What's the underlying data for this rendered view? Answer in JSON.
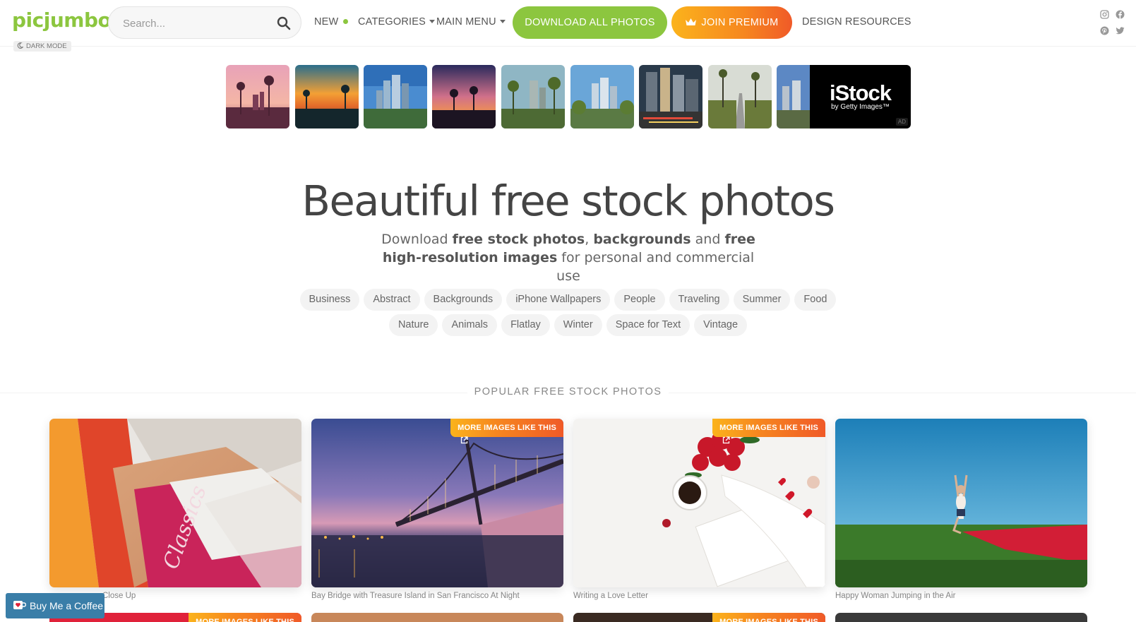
{
  "header": {
    "logo": "picjumbo",
    "search_placeholder": "Search...",
    "nav_new": "NEW",
    "nav_categories": "CATEGORIES",
    "nav_main_menu": "MAIN MENU",
    "download_all": "DOWNLOAD ALL PHOTOS",
    "join_premium": "JOIN PREMIUM",
    "design_resources": "DESIGN RESOURCES",
    "dark_mode": "DARK MODE",
    "social_icons": [
      "instagram-icon",
      "facebook-icon",
      "pinterest-icon",
      "twitter-icon"
    ]
  },
  "ad": {
    "brand": "iStock",
    "brand_sub": "by Getty Images™",
    "badge": "AD"
  },
  "hero": {
    "title": "Beautiful free stock photos",
    "sub_1": "Download ",
    "sub_2": "free stock photos",
    "sub_3": ", ",
    "sub_4": "backgrounds",
    "sub_5": " and ",
    "sub_6": "free high-resolution images",
    "sub_7": " for personal and commercial use"
  },
  "tags_row1": [
    "Business",
    "Abstract",
    "Backgrounds",
    "iPhone Wallpapers",
    "People",
    "Traveling",
    "Summer",
    "Food"
  ],
  "tags_row2": [
    "Nature",
    "Animals",
    "Flatlay",
    "Winter",
    "Space for Text",
    "Vintage"
  ],
  "popular": {
    "title": "POPULAR FREE STOCK PHOTOS",
    "more_label": "MORE IMAGES LIKE THIS",
    "photos": [
      {
        "caption": "Close Up"
      },
      {
        "caption": "Bay Bridge with Treasure Island in San Francisco At Night"
      },
      {
        "caption": "Writing a Love Letter"
      },
      {
        "caption": "Happy Woman Jumping in the Air"
      }
    ]
  },
  "bmc": {
    "label": "Buy Me a Coffee"
  },
  "colors": {
    "brand_green": "#8cc63f",
    "premium_orange": "#f6871f",
    "bmc_blue": "#3a7ea8"
  }
}
